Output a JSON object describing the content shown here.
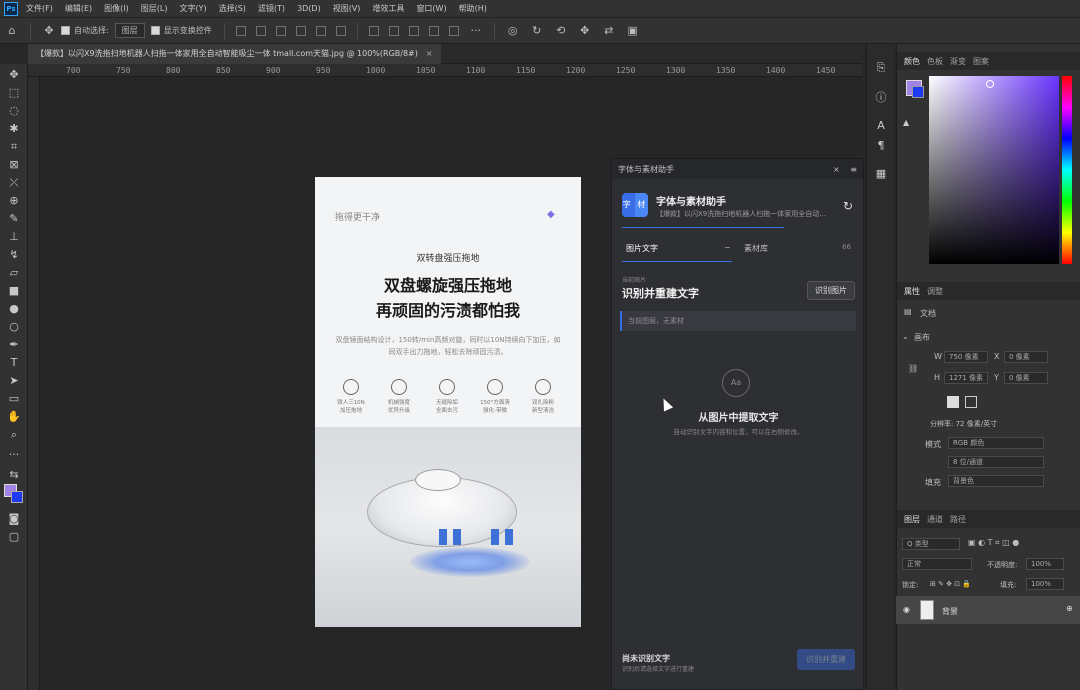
{
  "app": {
    "logo": "Ps"
  },
  "menu": [
    "文件(F)",
    "编辑(E)",
    "图像(I)",
    "图层(L)",
    "文字(Y)",
    "选择(S)",
    "滤镜(T)",
    "3D(D)",
    "视图(V)",
    "增效工具",
    "窗口(W)",
    "帮助(H)"
  ],
  "options": {
    "auto_select_label": "自动选择:",
    "auto_select_value": "图层",
    "transform_label": "显示变换控件"
  },
  "document": {
    "tab_title": "【爆款】以闪X9洗拖扫地机器人扫拖一体家用全自动智能吸尘一体 tmall.com天猫.jpg @ 100%(RGB/8#)",
    "close": "×"
  },
  "ruler_ticks": [
    "700",
    "750",
    "800",
    "850",
    "900",
    "950",
    "1000",
    "1050",
    "1100",
    "1150",
    "1200",
    "1250",
    "1300",
    "1350",
    "1400",
    "1450"
  ],
  "doc_content": {
    "brand": "拖得更干净",
    "subtitle": "双转盘强压拖地",
    "headline_1": "双盘螺旋强压拖地",
    "headline_2": "再顽固的污渍都怕我",
    "description": "双盘镜面结构设计，150转/min高频对旋，同时以10N持续向下加压，如同双手出力拖地，轻松去除顽固污渍。",
    "features": [
      "铁人三10N\n加压拖地",
      "机械强度\n优异升级",
      "无缝除垢\n全面去污",
      "150°方面清\n强化-带微",
      "双扎除粉\n新型清洁"
    ]
  },
  "plugin": {
    "panel_title": "字体与素材助手",
    "close": "×",
    "menu": "≡",
    "logo_text": "字 材",
    "title": "字体与素材助手",
    "desc": "【爆款】以闪X9洗拖扫地机器人扫拖一体家用全自动...",
    "refresh": "↻",
    "tab_active": "图片文字",
    "tab_minus": "−",
    "tab_inactive": "素材库",
    "tab_count": "66",
    "small_label": "当前图片",
    "section_title": "识别并重建文字",
    "recognize_button": "识别图片",
    "input_placeholder": "当前图层，无素材",
    "empty_icon": "Aa",
    "empty_title": "从图片中提取文字",
    "empty_desc": "自动识别文字内容和位置，可以在右侧修改。",
    "footer_title": "尚未识别文字",
    "footer_desc": "识别后请选择文字进行重建",
    "footer_button": "识别并重建"
  },
  "right_panel": {
    "color_tabs": [
      "颜色",
      "色板",
      "渐变",
      "图案"
    ],
    "props_tabs": [
      "属性",
      "调整"
    ],
    "doc_label": "文档",
    "canvas_label": "画布",
    "w_label": "W",
    "w_value": "750 像素",
    "x_label": "X",
    "x_value": "0 像素",
    "h_label": "H",
    "h_value": "1271 像素",
    "y_value": "0 像素",
    "resolution": "分辨率: 72 像素/英寸",
    "mode_label": "模式",
    "mode_value": "RGB 颜色",
    "bit_value": "8 位/通道",
    "fill_label": "填充",
    "fill_value": "背景色",
    "layer_tabs": [
      "图层",
      "通道",
      "路径"
    ],
    "layer_kind": "Q 类型",
    "blend_mode": "正常",
    "opacity_label": "不透明度:",
    "opacity_value": "100%",
    "lock_label": "锁定:",
    "fill2_label": "填充:",
    "fill2_value": "100%",
    "layer_name": "背景"
  },
  "colors": {
    "fg": "#a081e6",
    "bg": "#1e3af0",
    "accent": "#3a6ee8"
  }
}
